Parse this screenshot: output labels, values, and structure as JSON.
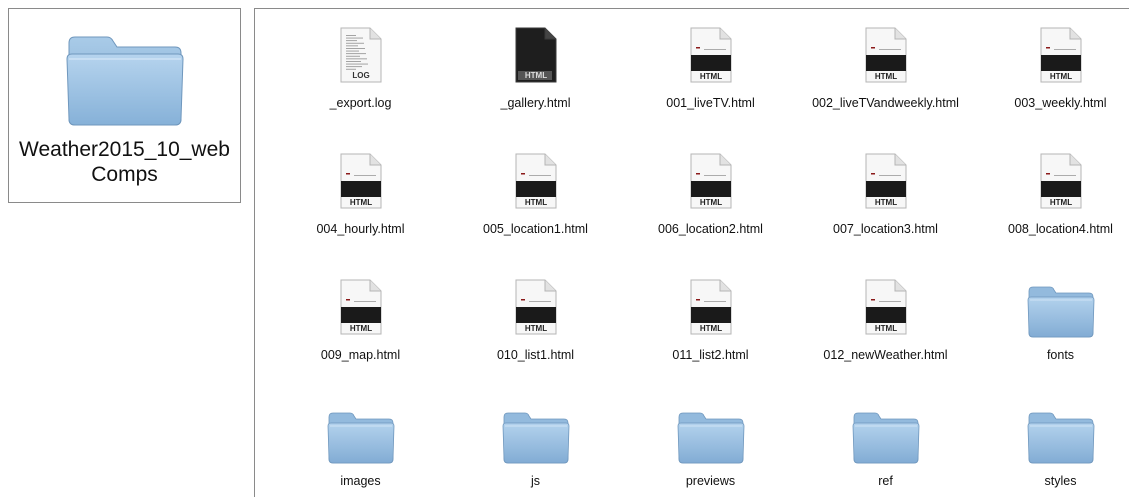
{
  "selected_folder": {
    "name": "Weather2015_10_webComps",
    "icon": "folder-icon",
    "color": "#8fb8dc"
  },
  "items": [
    {
      "name": "_export.log",
      "kind": "log",
      "badge": "LOG",
      "icon": "log-file-icon"
    },
    {
      "name": "_gallery.html",
      "kind": "html-dark",
      "badge": "HTML",
      "icon": "html-file-icon"
    },
    {
      "name": "001_liveTV.html",
      "kind": "html",
      "badge": "HTML",
      "icon": "html-file-icon"
    },
    {
      "name": "002_liveTVandweekly.html",
      "kind": "html",
      "badge": "HTML",
      "icon": "html-file-icon"
    },
    {
      "name": "003_weekly.html",
      "kind": "html",
      "badge": "HTML",
      "icon": "html-file-icon"
    },
    {
      "name": "004_hourly.html",
      "kind": "html",
      "badge": "HTML",
      "icon": "html-file-icon"
    },
    {
      "name": "005_location1.html",
      "kind": "html",
      "badge": "HTML",
      "icon": "html-file-icon"
    },
    {
      "name": "006_location2.html",
      "kind": "html",
      "badge": "HTML",
      "icon": "html-file-icon"
    },
    {
      "name": "007_location3.html",
      "kind": "html",
      "badge": "HTML",
      "icon": "html-file-icon"
    },
    {
      "name": "008_location4.html",
      "kind": "html",
      "badge": "HTML",
      "icon": "html-file-icon"
    },
    {
      "name": "009_map.html",
      "kind": "html",
      "badge": "HTML",
      "icon": "html-file-icon"
    },
    {
      "name": "010_list1.html",
      "kind": "html",
      "badge": "HTML",
      "icon": "html-file-icon"
    },
    {
      "name": "011_list2.html",
      "kind": "html",
      "badge": "HTML",
      "icon": "html-file-icon"
    },
    {
      "name": "012_newWeather.html",
      "kind": "html",
      "badge": "HTML",
      "icon": "html-file-icon"
    },
    {
      "name": "fonts",
      "kind": "folder",
      "badge": "",
      "icon": "folder-icon"
    },
    {
      "name": "images",
      "kind": "folder",
      "badge": "",
      "icon": "folder-icon"
    },
    {
      "name": "js",
      "kind": "folder",
      "badge": "",
      "icon": "folder-icon"
    },
    {
      "name": "previews",
      "kind": "folder",
      "badge": "",
      "icon": "folder-icon"
    },
    {
      "name": "ref",
      "kind": "folder",
      "badge": "",
      "icon": "folder-icon"
    },
    {
      "name": "styles",
      "kind": "folder",
      "badge": "",
      "icon": "folder-icon"
    }
  ]
}
